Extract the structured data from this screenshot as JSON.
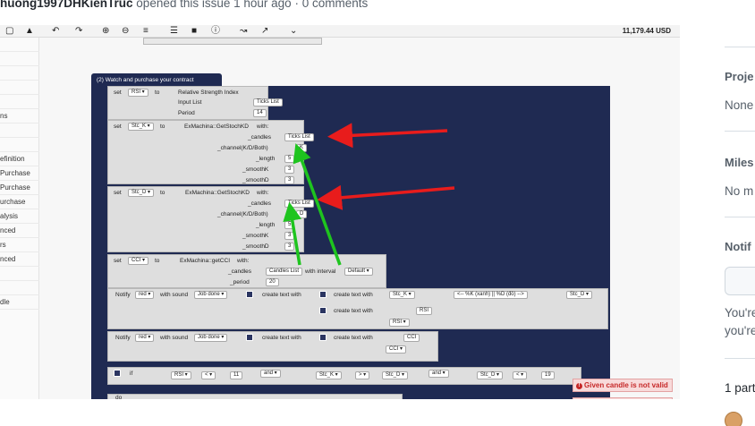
{
  "issue_header": {
    "author": "huong1997DHKienTruc",
    "action": "opened this issue",
    "time": "1 hour ago",
    "sep": "·",
    "comments": "0 comments"
  },
  "toolbar": {
    "icons": [
      "save-icon",
      "drive-icon",
      "undo-icon",
      "redo-icon",
      "zoom-in-icon",
      "zoom-out-icon",
      "rearrange-icon",
      "list-icon",
      "stop-icon",
      "info-icon",
      "chart-icon",
      "indicator-icon",
      "chevron-down-icon"
    ],
    "balance": "11,179.44 USD"
  },
  "left_nav": {
    "items": [
      "",
      "",
      "",
      "",
      "",
      "ns",
      "",
      "",
      "efinition",
      "Purchase",
      "Purchase",
      "urchase",
      "alysis",
      "nced",
      "rs",
      "nced",
      "",
      "",
      "dle"
    ]
  },
  "blocks": {
    "hat_title": "(2) Watch and purchase your contract",
    "set": "set",
    "to": "to",
    "with": "with:",
    "rsi_var": "RSI",
    "rsi_func": "Relative Strength Index",
    "input_list": "Input List",
    "ticks_list": "Ticks List",
    "period": "Period",
    "period_val": "14",
    "stck_var": "Stc_K",
    "stcd_var": "Stc_D",
    "stoch_func": "ExMachina::GetStochKD",
    "candles": "_candles",
    "channel": "_channel(K/D/Both)",
    "length": "_length",
    "smoothk": "_smoothK",
    "smoothd": "_smoothD",
    "k_val": "K",
    "d_val": "D",
    "num_5": "5",
    "num_3": "3",
    "cci_var": "CCI",
    "cci_func": "ExMachina::getCCI",
    "cci_candles": "_candles",
    "candles_list": "Candles List",
    "with_interval": "with interval",
    "default_opt": "Default",
    "cci_period": "_period",
    "cci_period_val": "20",
    "notify": "Notify",
    "red": "red",
    "with_sound": "with sound",
    "job_done": "Job done",
    "create_text_with": "create text with",
    "kd_label": "<-- %K (xanh) || %D (đỏ) -->",
    "if": "if",
    "lt": "<",
    "gt": ">",
    "and": "and",
    "num_11": "11",
    "num_19": "19",
    "do": "do"
  },
  "errors": {
    "message": "Given candle is not valid"
  },
  "sidebar": {
    "projects_head": "Proje",
    "projects_val": "None",
    "milestone_head": "Miles",
    "milestone_val": "No m",
    "notif_head": "Notif",
    "notif_text_1": "You're",
    "notif_text_2": "you're",
    "participants": "1 part"
  },
  "colors": {
    "block_navy": "#1f2a52",
    "arrow_red": "#e81c1c",
    "arrow_green": "#1ec41e",
    "error_red": "#c62828"
  }
}
